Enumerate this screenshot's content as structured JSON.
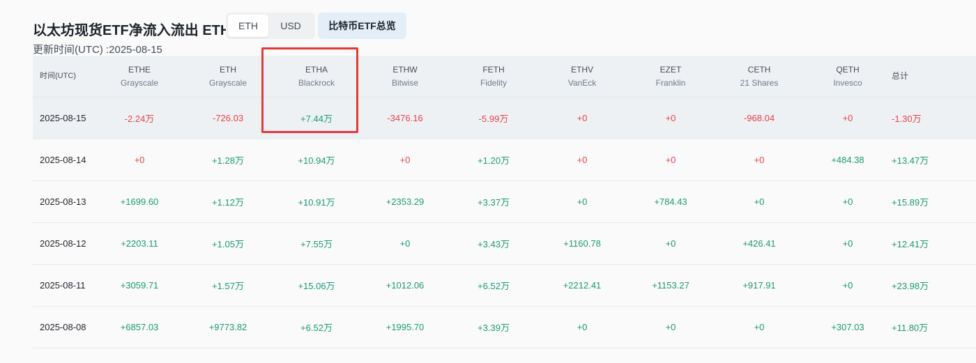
{
  "header": {
    "title": "以太坊现货ETF净流入流出 ETH",
    "unit_toggle": {
      "eth_label": "ETH",
      "usd_label": "USD",
      "selected": "ETH"
    },
    "btc_overview_label": "比特币ETF总览",
    "updated": "更新时间(UTC) :2025-08-15"
  },
  "table": {
    "date_header": "时间(UTC)",
    "total_header": "总计",
    "columns": [
      {
        "ticker": "ETHE",
        "issuer": "Grayscale"
      },
      {
        "ticker": "ETH",
        "issuer": "Grayscale"
      },
      {
        "ticker": "ETHA",
        "issuer": "Blackrock"
      },
      {
        "ticker": "ETHW",
        "issuer": "Bitwise"
      },
      {
        "ticker": "FETH",
        "issuer": "Fidelity"
      },
      {
        "ticker": "ETHV",
        "issuer": "VanEck"
      },
      {
        "ticker": "EZET",
        "issuer": "Franklin"
      },
      {
        "ticker": "CETH",
        "issuer": "21 Shares"
      },
      {
        "ticker": "QETH",
        "issuer": "Invesco"
      }
    ],
    "rows": [
      {
        "date": "2025-08-15",
        "values": [
          "-2.24万",
          "-726.03",
          "+7.44万",
          "-3476.16",
          "-5.99万",
          "+0",
          "+0",
          "-968.04",
          "+0"
        ],
        "total": "-1.30万"
      },
      {
        "date": "2025-08-14",
        "values": [
          "+0",
          "+1.28万",
          "+10.94万",
          "+0",
          "+1.20万",
          "+0",
          "+0",
          "+0",
          "+484.38"
        ],
        "total": "+13.47万"
      },
      {
        "date": "2025-08-13",
        "values": [
          "+1699.60",
          "+1.12万",
          "+10.91万",
          "+2353.29",
          "+3.37万",
          "+0",
          "+784.43",
          "+0",
          "+0"
        ],
        "total": "+15.89万"
      },
      {
        "date": "2025-08-12",
        "values": [
          "+2203.11",
          "+1.05万",
          "+7.55万",
          "+0",
          "+3.43万",
          "+1160.78",
          "+0",
          "+426.41",
          "+0"
        ],
        "total": "+12.41万"
      },
      {
        "date": "2025-08-11",
        "values": [
          "+3059.71",
          "+1.57万",
          "+15.06万",
          "+1012.06",
          "+6.52万",
          "+2212.41",
          "+1153.27",
          "+917.91",
          "+0"
        ],
        "total": "+23.98万"
      },
      {
        "date": "2025-08-08",
        "values": [
          "+6857.03",
          "+9773.82",
          "+6.52万",
          "+1995.70",
          "+3.39万",
          "+0",
          "+0",
          "+0",
          "+307.03"
        ],
        "total": "+11.80万"
      }
    ],
    "value_colors": {
      "pos": "#1a9c6c",
      "neg": "#e5434a",
      "zero_colored_as": "neg for 2025-08-15 / 2025-08-14 ETHE / 2025-08-14 ETHW-ETHV-EZET-CETH, pos otherwise"
    }
  },
  "annotation": {
    "highlight_color": "#e53935",
    "highlighted_column": "ETHA"
  }
}
